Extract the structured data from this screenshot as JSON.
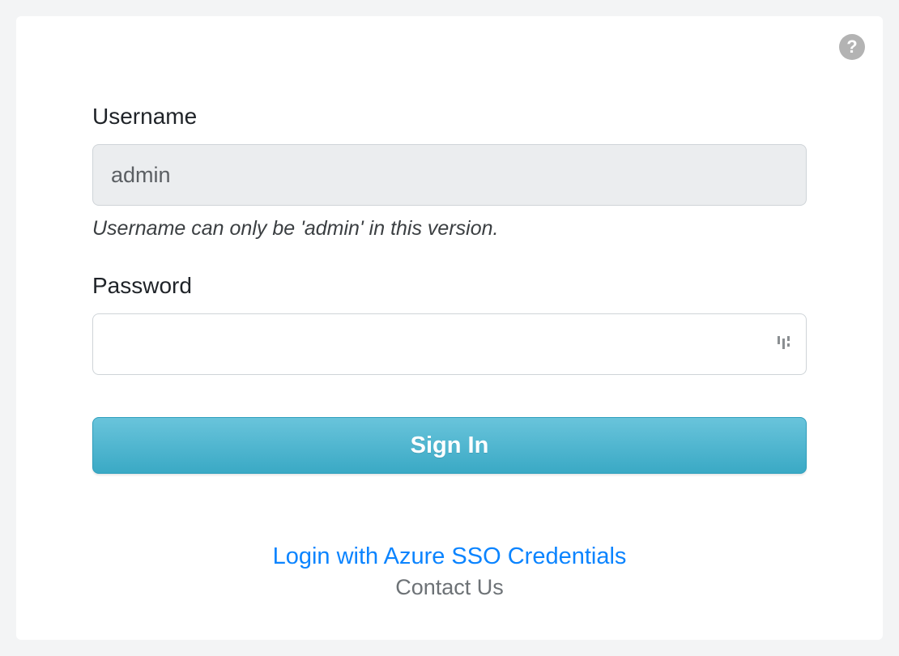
{
  "help_icon": "help-circle-icon",
  "form": {
    "username": {
      "label": "Username",
      "value": "admin",
      "disabled": true,
      "help_text": "Username can only be 'admin' in this version."
    },
    "password": {
      "label": "Password",
      "value": "",
      "placeholder": ""
    },
    "submit_label": "Sign In"
  },
  "links": {
    "sso": "Login with Azure SSO Credentials",
    "contact": "Contact Us"
  },
  "colors": {
    "accent_blue": "#0b84ff",
    "button_gradient_top": "#69c4db",
    "button_gradient_bottom": "#3aa9c5",
    "help_icon_fill": "#b3b3b3"
  }
}
